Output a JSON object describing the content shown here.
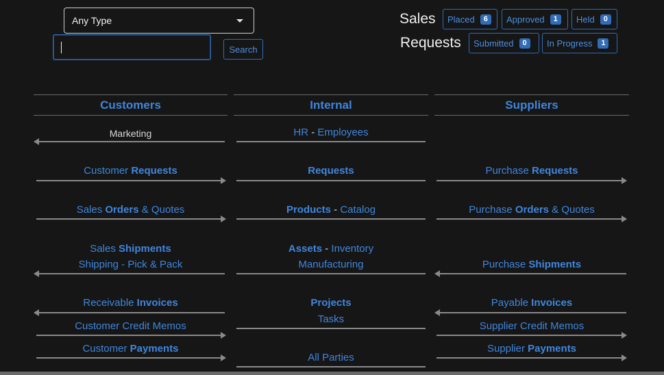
{
  "search": {
    "type_select_value": "Any Type",
    "input_value": "",
    "button_label": "Search"
  },
  "status": {
    "sales_title": "Sales",
    "requests_title": "Requests",
    "sales_pills": [
      {
        "label": "Placed",
        "count": "6"
      },
      {
        "label": "Approved",
        "count": "1"
      },
      {
        "label": "Held",
        "count": "0"
      }
    ],
    "request_pills": [
      {
        "label": "Submitted",
        "count": "0"
      },
      {
        "label": "In Progress",
        "count": "1"
      }
    ]
  },
  "columns": {
    "customers": "Customers",
    "internal": "Internal",
    "suppliers": "Suppliers"
  },
  "links": {
    "marketing": "Marketing",
    "hr": "HR",
    "hr_sep": " - ",
    "employees": "Employees",
    "customer_requests_a": "Customer ",
    "customer_requests_b": "Requests",
    "requests": "Requests",
    "purchase_requests_a": "Purchase ",
    "purchase_requests_b": "Requests",
    "sales_orders_a": "Sales ",
    "sales_orders_b": "Orders",
    "sales_orders_c": " & Quotes",
    "products": "Products",
    "products_sep": " - ",
    "catalog": "Catalog",
    "purchase_orders_a": "Purchase ",
    "purchase_orders_b": "Orders",
    "purchase_orders_c": " & Quotes",
    "sales_shipments_a": "Sales ",
    "sales_shipments_b": "Shipments",
    "shipping_pick_pack": "Shipping - Pick & Pack",
    "assets": "Assets",
    "assets_sep": " - ",
    "inventory": "Inventory",
    "manufacturing": "Manufacturing",
    "purchase_shipments_a": "Purchase ",
    "purchase_shipments_b": "Shipments",
    "receivable_invoices_a": "Receivable ",
    "receivable_invoices_b": "Invoices",
    "projects": "Projects",
    "tasks": "Tasks",
    "payable_invoices_a": "Payable ",
    "payable_invoices_b": "Invoices",
    "customer_credit_memos": "Customer Credit Memos",
    "supplier_credit_memos": "Supplier Credit Memos",
    "customer_payments_a": "Customer ",
    "customer_payments_b": "Payments",
    "all_parties": "All Parties",
    "supplier_payments_a": "Supplier ",
    "supplier_payments_b": "Payments"
  }
}
